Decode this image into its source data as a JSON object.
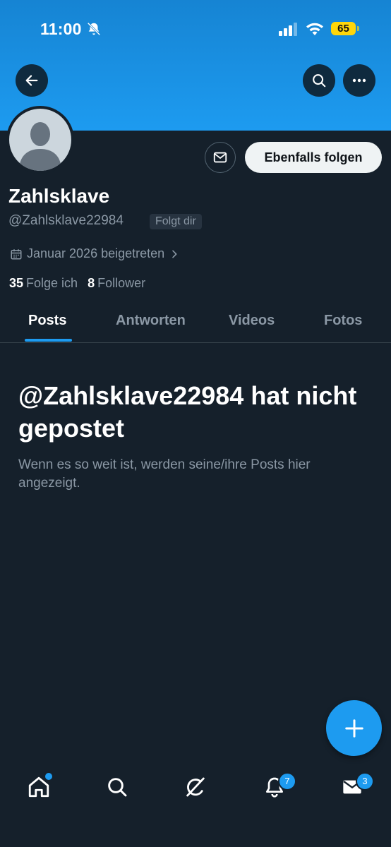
{
  "status_bar": {
    "time": "11:00",
    "battery": "65",
    "icons": [
      "bell-muted-icon",
      "signal-icon",
      "wifi-icon",
      "battery-icon"
    ]
  },
  "header": {
    "back_icon": "arrow-left-icon",
    "search_icon": "search-icon",
    "more_icon": "more-horizontal-icon",
    "banner_color": "#1d9bf0"
  },
  "profile": {
    "display_name": "Zahlsklave",
    "handle": "@Zahlsklave22984",
    "follows_you": "Folgt dir",
    "joined": "Januar 2026 beigetreten",
    "following_count": "35",
    "following_label": "Folge ich",
    "followers_count": "8",
    "followers_label": "Follower",
    "message_icon": "envelope-icon",
    "follow_button": "Ebenfalls folgen"
  },
  "tabs": [
    {
      "label": "Posts",
      "active": true
    },
    {
      "label": "Antworten",
      "active": false
    },
    {
      "label": "Videos",
      "active": false
    },
    {
      "label": "Fotos",
      "active": false
    }
  ],
  "empty_state": {
    "title": "@Zahlsklave22984 hat nicht gepostet",
    "subtitle": "Wenn es so weit ist, werden seine/ihre Posts hier angezeigt."
  },
  "fab": {
    "icon": "plus-icon"
  },
  "bottom_nav": {
    "items": [
      "home-icon",
      "search-icon",
      "grok-icon",
      "notifications-icon",
      "messages-icon"
    ],
    "notifications_badge": "7",
    "messages_badge": "3"
  },
  "colors": {
    "background": "#15202b",
    "accent": "#1d9bf0",
    "secondary_text": "#8b98a5"
  }
}
